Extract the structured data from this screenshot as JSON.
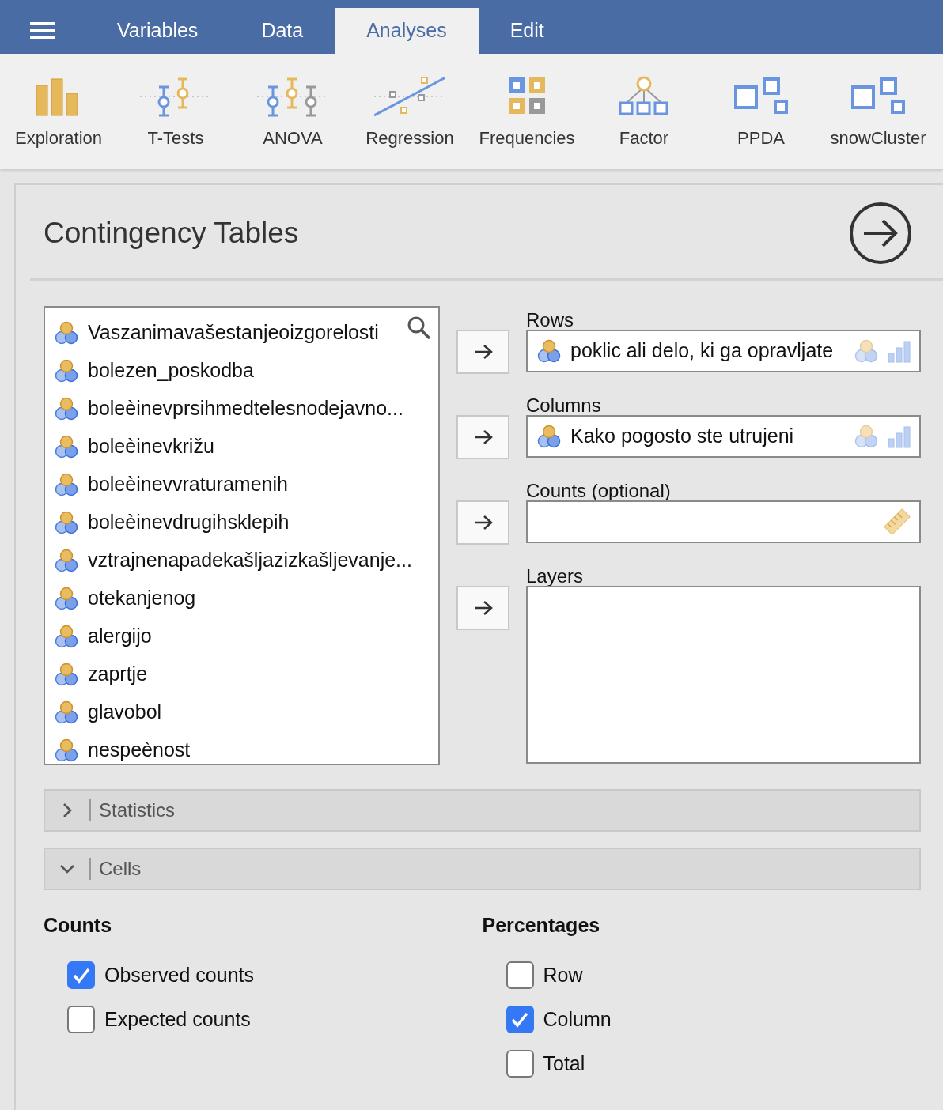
{
  "menu_tabs": [
    {
      "label": "Variables",
      "selected": false
    },
    {
      "label": "Data",
      "selected": false
    },
    {
      "label": "Analyses",
      "selected": true
    },
    {
      "label": "Edit",
      "selected": false
    }
  ],
  "analyses": [
    "Exploration",
    "T-Tests",
    "ANOVA",
    "Regression",
    "Frequencies",
    "Factor",
    "PPDA",
    "snowCluster"
  ],
  "panel": {
    "title": "Contingency Tables"
  },
  "variables": [
    "Vaszanimavašestanjeoizgorelosti",
    "bolezen_poskodba",
    "boleèinevprsihmedtelesnodejavno...",
    "boleèinevkrižu",
    "boleèinevvraturamenih",
    "boleèinevdrugihsklepih",
    "vztrajnenapadekašljazizkašljevanje...",
    "otekanjenog",
    "alergijo",
    "zaprtje",
    "glavobol",
    "nespeènost"
  ],
  "targets": [
    {
      "label": "Rows",
      "kind": "factor",
      "items": [
        "poklic ali delo, ki ga opravljate"
      ]
    },
    {
      "label": "Columns",
      "kind": "factor",
      "items": [
        "Kako pogosto ste utrujeni"
      ]
    },
    {
      "label": "Counts (optional)",
      "kind": "count"
    },
    {
      "label": "Layers",
      "kind": "layers"
    }
  ],
  "sections": [
    {
      "label": "Statistics",
      "expanded": false
    },
    {
      "label": "Cells",
      "expanded": true
    }
  ],
  "cells": [
    {
      "heading": "Counts",
      "options": [
        {
          "label": "Observed counts",
          "checked": true
        },
        {
          "label": "Expected counts",
          "checked": false
        }
      ]
    },
    {
      "heading": "Percentages",
      "options": [
        {
          "label": "Row",
          "checked": false
        },
        {
          "label": "Column",
          "checked": true
        },
        {
          "label": "Total",
          "checked": false
        }
      ]
    }
  ]
}
